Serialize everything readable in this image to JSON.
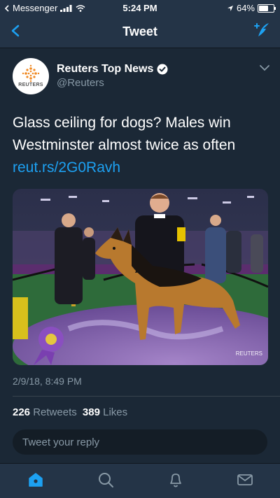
{
  "status_bar": {
    "carrier": "Messenger",
    "time": "5:24 PM",
    "battery_text": "64%",
    "battery_level": 0.64
  },
  "nav": {
    "title": "Tweet",
    "back_icon": "chevron-left-icon",
    "compose_icon": "compose-tweet-icon"
  },
  "tweet": {
    "author": {
      "name": "Reuters Top News",
      "handle": "@Reuters",
      "verified": true,
      "avatar_brand": "REUTERS"
    },
    "text": "Glass ceiling for dogs? Males win Westminster almost twice as often",
    "link": "reut.rs/2G0Ravh",
    "media": {
      "watermark": "REUTERS"
    },
    "timestamp": "2/9/18, 8:49 PM",
    "stats": {
      "retweets_count": "226",
      "retweets_label": "Retweets",
      "likes_count": "389",
      "likes_label": "Likes"
    }
  },
  "reply": {
    "placeholder": "Tweet your reply"
  },
  "tabbar": {
    "items": [
      "home-icon",
      "search-icon",
      "notifications-icon",
      "messages-icon"
    ],
    "active": "home-icon"
  },
  "colors": {
    "background": "#1b2836",
    "bar": "#243447",
    "accent": "#1da1f2",
    "muted": "#8899a6"
  }
}
